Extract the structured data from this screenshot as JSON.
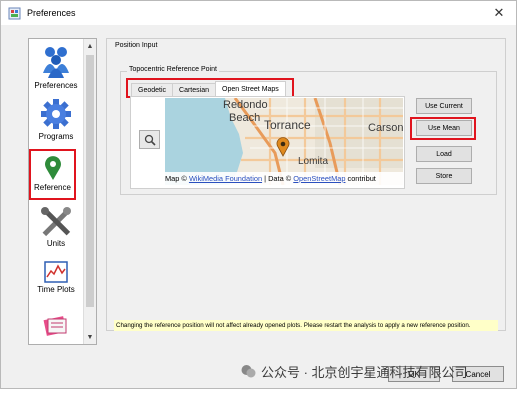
{
  "window": {
    "title": "Preferences",
    "close_glyph": "✕"
  },
  "sidebar": {
    "items": [
      {
        "label": "Preferences",
        "icon": "users-icon"
      },
      {
        "label": "Programs",
        "icon": "gear-icon"
      },
      {
        "label": "Reference",
        "icon": "map-pin-icon",
        "selected": true
      },
      {
        "label": "Units",
        "icon": "tools-icon"
      },
      {
        "label": "Time Plots",
        "icon": "chart-icon"
      }
    ]
  },
  "position_input": {
    "label": "Position Input"
  },
  "reference_point": {
    "label": "Topocentric Reference Point"
  },
  "tabs": [
    {
      "label": "Geodetic"
    },
    {
      "label": "Cartesian"
    },
    {
      "label": "Open Street Maps",
      "active": true
    }
  ],
  "map": {
    "places": [
      "Redondo",
      "Beach",
      "Torrance",
      "Carson",
      "Lomita"
    ],
    "attribution": {
      "prefix": "Map © ",
      "link1": "WikiMedia Foundation",
      "middle": " | Data © ",
      "link2": "OpenStreetMap",
      "suffix": " contribut"
    }
  },
  "buttons": {
    "use_current": "Use Current",
    "use_mean": "Use Mean",
    "load": "Load",
    "store": "Store"
  },
  "notice": "Changing the reference position will not affect already opened plots. Please restart the analysis to apply a new reference position.",
  "footer": {
    "ok": "OK",
    "cancel": "Cancel"
  },
  "watermark": "公众号 · 北京创宇星通科技有限公司",
  "colors": {
    "highlight": "#e0141e",
    "notice_bg": "#ffffc8",
    "link": "#2a4fbf"
  }
}
